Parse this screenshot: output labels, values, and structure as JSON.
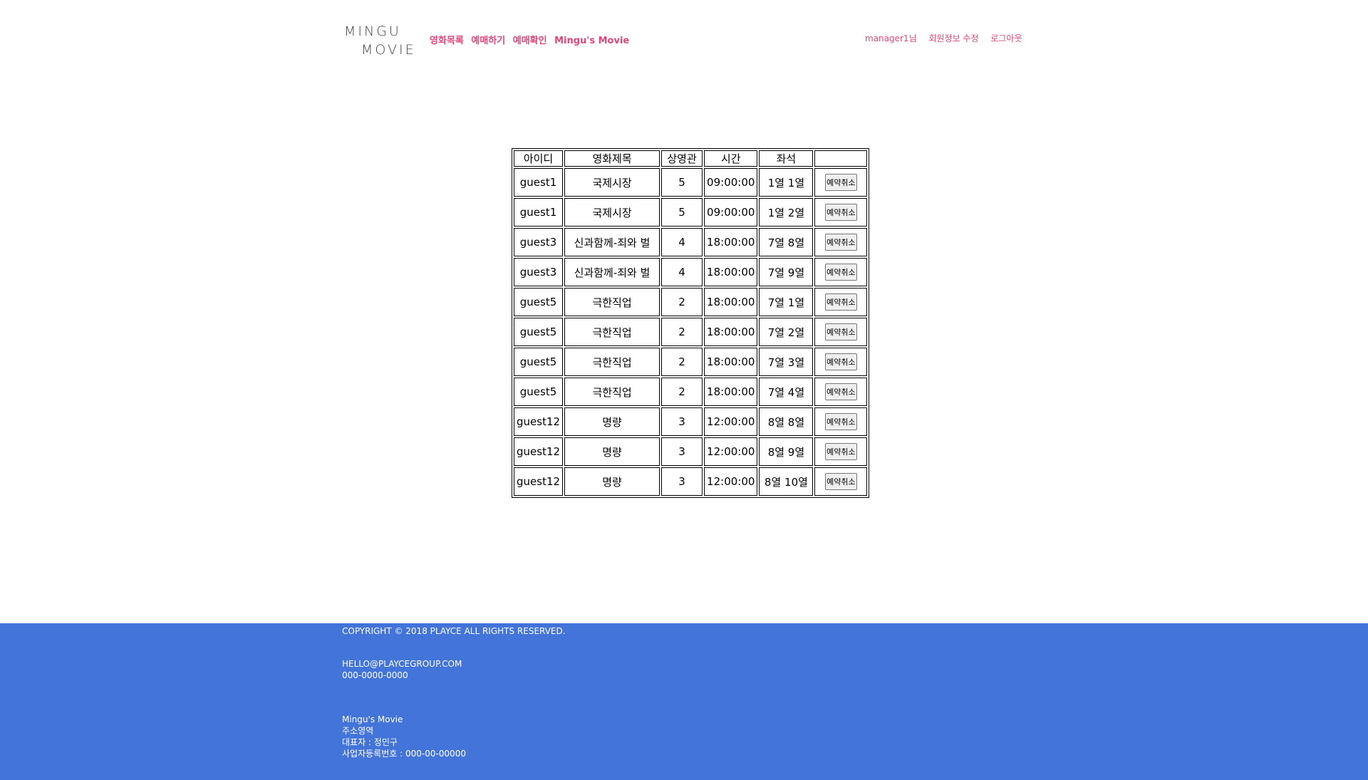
{
  "header": {
    "logo_line1": "MINGU",
    "logo_line2": "MOVIE",
    "nav": [
      "영화목록",
      "예매하기",
      "예매확인",
      "Mingu's Movie"
    ],
    "user": "manager1님",
    "edit_profile": "회원정보 수정",
    "logout": "로그아웃"
  },
  "table": {
    "headers": [
      "아이디",
      "영화제목",
      "상영관",
      "시간",
      "좌석",
      ""
    ],
    "cancel_label": "예약취소",
    "rows": [
      [
        "guest1",
        "국제시장",
        "5",
        "09:00:00",
        "1열 1열"
      ],
      [
        "guest1",
        "국제시장",
        "5",
        "09:00:00",
        "1열 2열"
      ],
      [
        "guest3",
        "신과함께-죄와 벌",
        "4",
        "18:00:00",
        "7열 8열"
      ],
      [
        "guest3",
        "신과함께-죄와 벌",
        "4",
        "18:00:00",
        "7열 9열"
      ],
      [
        "guest5",
        "극한직업",
        "2",
        "18:00:00",
        "7열 1열"
      ],
      [
        "guest5",
        "극한직업",
        "2",
        "18:00:00",
        "7열 2열"
      ],
      [
        "guest5",
        "극한직업",
        "2",
        "18:00:00",
        "7열 3열"
      ],
      [
        "guest5",
        "극한직업",
        "2",
        "18:00:00",
        "7열 4열"
      ],
      [
        "guest12",
        "명량",
        "3",
        "12:00:00",
        "8열 8열"
      ],
      [
        "guest12",
        "명량",
        "3",
        "12:00:00",
        "8열 9열"
      ],
      [
        "guest12",
        "명량",
        "3",
        "12:00:00",
        "8열 10열"
      ]
    ]
  },
  "footer": {
    "copyright": "COPYRIGHT © 2018 PLAYCE ALL RIGHTS RESERVED.",
    "email": "HELLO@PLAYCEGROUP.COM",
    "phone": "000-0000-0000",
    "company": "Mingu's Movie",
    "address": "주소영역",
    "ceo": "대표자 : 정민구",
    "biz_no": "사업자등록번호 : 000-00-00000"
  },
  "colors": {
    "accent": "#e0457b",
    "footer_bg": "#4374d9"
  }
}
